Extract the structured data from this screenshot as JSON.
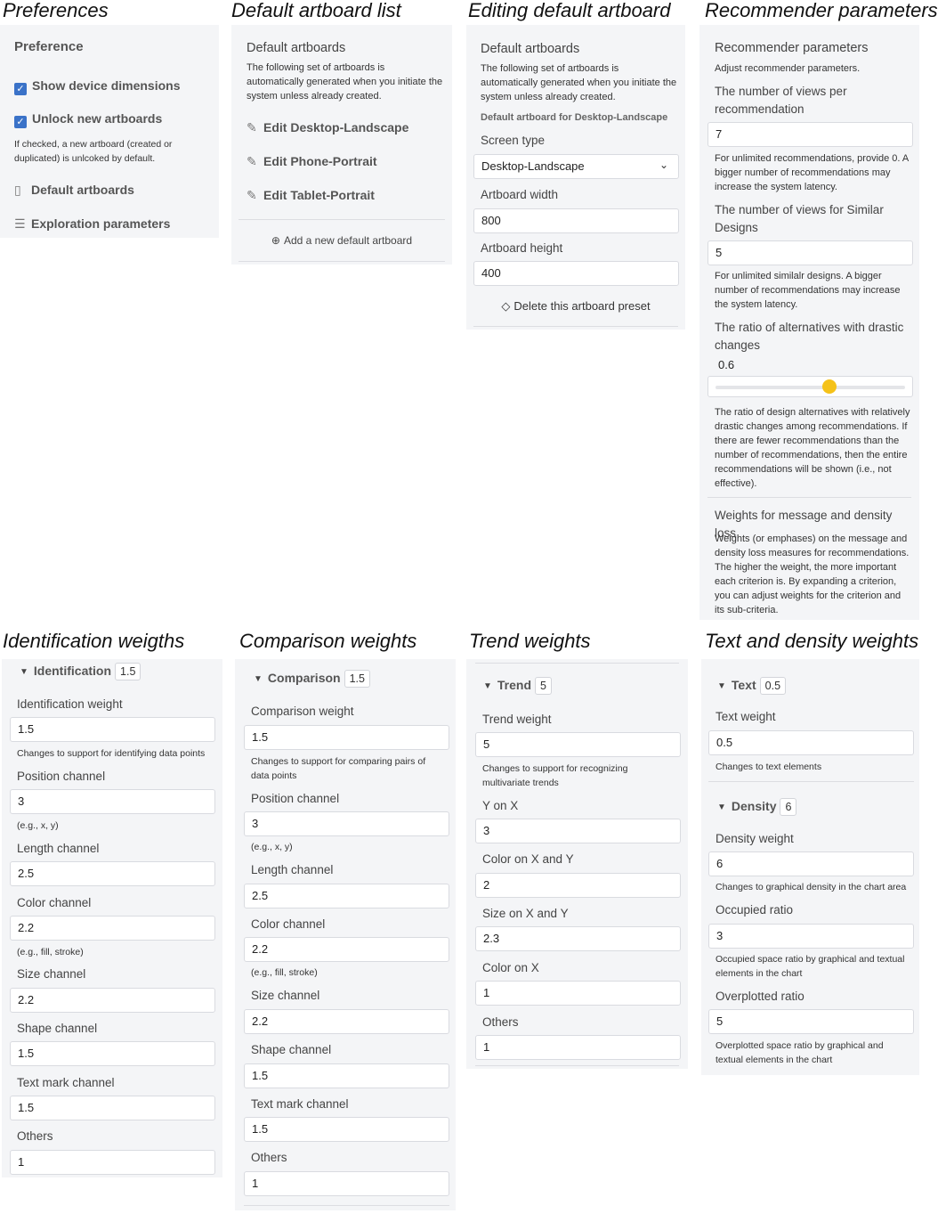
{
  "captions": {
    "preferences": "Preferences",
    "default_list": "Default artboard list",
    "editing": "Editing default artboard",
    "recommender": "Recommender parameters",
    "identification": "Identification weigths",
    "comparison": "Comparison weights",
    "trend": "Trend weights",
    "text_density": "Text and density weights"
  },
  "preferences": {
    "title": "Preference",
    "show_dimensions": "Show device dimensions",
    "unlock_new": "Unlock new artboards",
    "unlock_help": "If checked, a new artboard (created or duplicated) is unlcoked by default.",
    "default_artboards": "Default artboards",
    "exploration": "Exploration parameters"
  },
  "default_list": {
    "title": "Default artboards",
    "desc": "The following set of artboards is automatically generated when you initiate the system unless already created.",
    "items": [
      "Edit Desktop-Landscape",
      "Edit Phone-Portrait",
      "Edit Tablet-Portrait"
    ],
    "add": "Add a new default artboard"
  },
  "editing": {
    "title": "Default artboards",
    "desc": "The following set of artboards is automatically generated when you initiate the system unless already created.",
    "subtitle": "Default artboard for Desktop-Landscape",
    "screen_type_label": "Screen type",
    "screen_type_value": "Desktop-Landscape",
    "width_label": "Artboard width",
    "width_value": "800",
    "height_label": "Artboard height",
    "height_value": "400",
    "delete": "Delete this artboard preset"
  },
  "recommender": {
    "title": "Recommender parameters",
    "desc": "Adjust recommender parameters.",
    "views_label": "The number of views per recommendation",
    "views_value": "7",
    "views_help": "For unlimited recommendations, provide 0. A bigger number of recommendations may increase the system latency.",
    "similar_label": "The number of views for Similar Designs",
    "similar_value": "5",
    "similar_help": "For unlimited similalr designs. A bigger number of recommendations may increase the system latency.",
    "ratio_label": "The ratio of alternatives with drastic changes",
    "ratio_value": "0.6",
    "ratio_fraction": 0.6,
    "ratio_help": "The ratio of design alternatives with relatively drastic changes among recommendations. If there are fewer recommendations than the number of recommendations, then the entire recommendations will be shown (i.e., not effective).",
    "weights_title": "Weights for message and density loss",
    "weights_help": "Weights (or emphases) on the message and density loss measures for recommendations. The higher the weight, the more important each criterion is. By expanding a criterion, you can adjust weights for the criterion and its sub-criteria."
  },
  "identification": {
    "name": "Identification",
    "badge": "1.5",
    "weight_label": "Identification weight",
    "weight_value": "1.5",
    "help": "Changes to support for identifying data points",
    "fields": [
      {
        "label": "Position channel",
        "value": "3",
        "note": "(e.g., x, y)"
      },
      {
        "label": "Length channel",
        "value": "2.5",
        "note": ""
      },
      {
        "label": "Color channel",
        "value": "2.2",
        "note": "(e.g., fill, stroke)"
      },
      {
        "label": "Size channel",
        "value": "2.2",
        "note": ""
      },
      {
        "label": "Shape channel",
        "value": "1.5",
        "note": ""
      },
      {
        "label": "Text mark channel",
        "value": "1.5",
        "note": ""
      },
      {
        "label": "Others",
        "value": "1",
        "note": ""
      }
    ]
  },
  "comparison": {
    "name": "Comparison",
    "badge": "1.5",
    "weight_label": "Comparison weight",
    "weight_value": "1.5",
    "help": "Changes to support for comparing pairs of data points",
    "fields": [
      {
        "label": "Position channel",
        "value": "3",
        "note": "(e.g., x, y)"
      },
      {
        "label": "Length channel",
        "value": "2.5",
        "note": ""
      },
      {
        "label": "Color channel",
        "value": "2.2",
        "note": "(e.g., fill, stroke)"
      },
      {
        "label": "Size channel",
        "value": "2.2",
        "note": ""
      },
      {
        "label": "Shape channel",
        "value": "1.5",
        "note": ""
      },
      {
        "label": "Text mark channel",
        "value": "1.5",
        "note": ""
      },
      {
        "label": "Others",
        "value": "1",
        "note": ""
      }
    ]
  },
  "trend": {
    "name": "Trend",
    "badge": "5",
    "weight_label": "Trend weight",
    "weight_value": "5",
    "help": "Changes to support for recognizing multivariate trends",
    "fields": [
      {
        "label": "Y on X",
        "value": "3"
      },
      {
        "label": "Color on X and Y",
        "value": "2"
      },
      {
        "label": "Size on X and Y",
        "value": "2.3"
      },
      {
        "label": "Color on X",
        "value": "1"
      },
      {
        "label": "Others",
        "value": "1"
      }
    ]
  },
  "text": {
    "name": "Text",
    "badge": "0.5",
    "weight_label": "Text weight",
    "weight_value": "0.5",
    "help": "Changes to text elements"
  },
  "density": {
    "name": "Density",
    "badge": "6",
    "weight_label": "Density weight",
    "weight_value": "6",
    "help": "Changes to graphical density in the chart area",
    "occupied_label": "Occupied ratio",
    "occupied_value": "3",
    "occupied_help": "Occupied space ratio by graphical and textual elements in the chart",
    "overplotted_label": "Overplotted ratio",
    "overplotted_value": "5",
    "overplotted_help": "Overplotted space ratio by graphical and textual elements in the chart"
  },
  "colors": {
    "accent": "#3a72c8",
    "slider_thumb": "#f5c219",
    "panel_bg": "#f4f5f7"
  }
}
